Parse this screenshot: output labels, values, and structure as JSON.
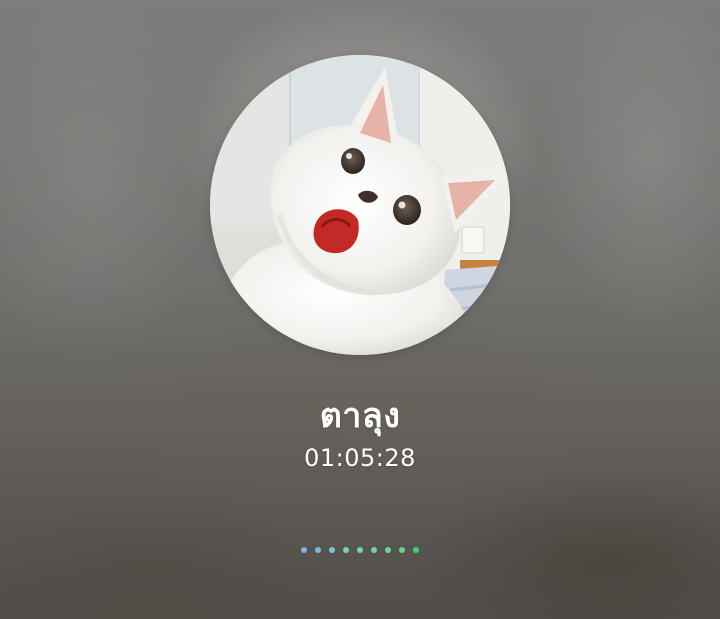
{
  "call": {
    "caller_name": "ตาลุง",
    "duration": "01:05:28"
  },
  "avatar": {
    "description_icon": "cat-photo-icon"
  },
  "connection_indicator": {
    "dots": [
      {
        "color": "#7fb0e0"
      },
      {
        "color": "#7fb8dc"
      },
      {
        "color": "#7ec2d6"
      },
      {
        "color": "#7ccacc"
      },
      {
        "color": "#78d0bf"
      },
      {
        "color": "#72d2b0"
      },
      {
        "color": "#6cd59f"
      },
      {
        "color": "#62d78c"
      },
      {
        "color": "#3fd36e"
      }
    ]
  },
  "colors": {
    "text": "#ffffff",
    "background": "#7a7976"
  }
}
